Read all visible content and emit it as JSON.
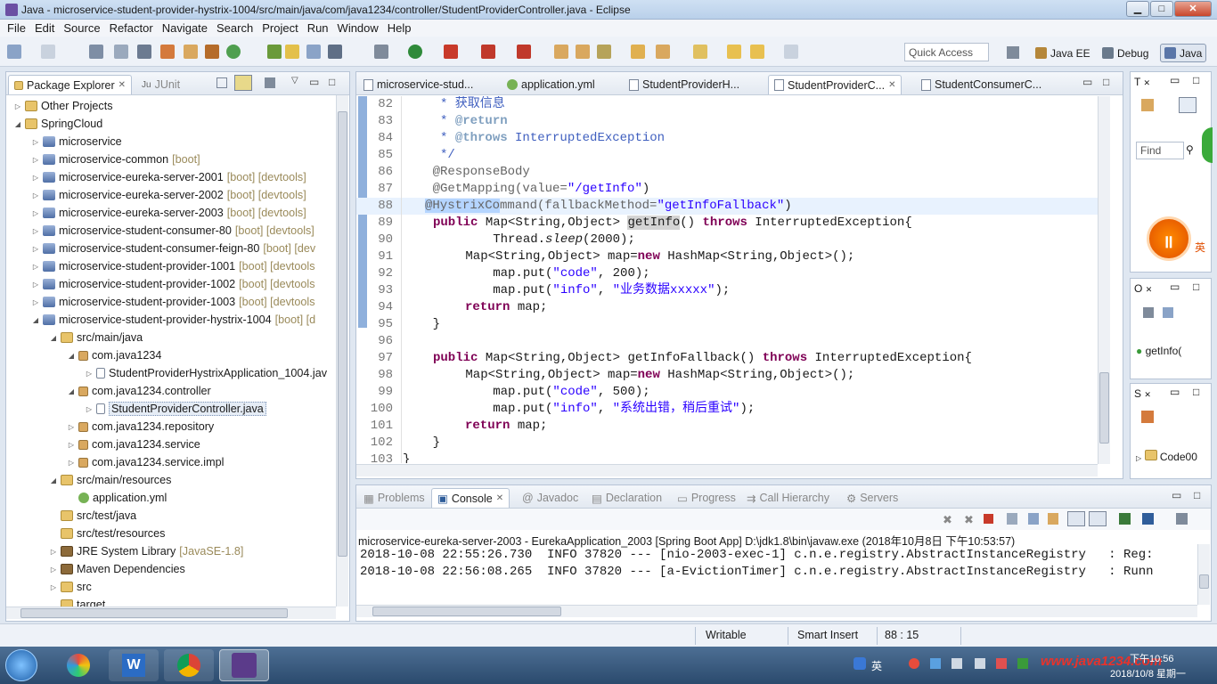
{
  "window": {
    "title": "Java - microservice-student-provider-hystrix-1004/src/main/java/com/java1234/controller/StudentProviderController.java - Eclipse",
    "minimize": "▁",
    "maximize": "□",
    "close": "✕"
  },
  "menu": [
    "File",
    "Edit",
    "Source",
    "Refactor",
    "Navigate",
    "Search",
    "Project",
    "Run",
    "Window",
    "Help"
  ],
  "toolbar": {
    "quick_access_placeholder": "Quick Access",
    "perspectives": [
      "Java EE",
      "Debug",
      "Java"
    ]
  },
  "package_explorer": {
    "tabs": [
      "Package Explorer",
      "JUnit"
    ],
    "items": [
      {
        "label": "Other Projects",
        "deco": ""
      },
      {
        "label": "SpringCloud",
        "deco": ""
      },
      {
        "label": "microservice",
        "deco": ""
      },
      {
        "label": "microservice-common",
        "deco": "[boot]"
      },
      {
        "label": "microservice-eureka-server-2001",
        "deco": "[boot] [devtools]"
      },
      {
        "label": "microservice-eureka-server-2002",
        "deco": "[boot] [devtools]"
      },
      {
        "label": "microservice-eureka-server-2003",
        "deco": "[boot] [devtools]"
      },
      {
        "label": "microservice-student-consumer-80",
        "deco": "[boot] [devtools]"
      },
      {
        "label": "microservice-student-consumer-feign-80",
        "deco": "[boot] [dev"
      },
      {
        "label": "microservice-student-provider-1001",
        "deco": "[boot] [devtools"
      },
      {
        "label": "microservice-student-provider-1002",
        "deco": "[boot] [devtools"
      },
      {
        "label": "microservice-student-provider-1003",
        "deco": "[boot] [devtools"
      },
      {
        "label": "microservice-student-provider-hystrix-1004",
        "deco": "[boot] [d"
      },
      {
        "label": "src/main/java",
        "deco": ""
      },
      {
        "label": "com.java1234",
        "deco": ""
      },
      {
        "label": "StudentProviderHystrixApplication_1004.jav",
        "deco": ""
      },
      {
        "label": "com.java1234.controller",
        "deco": ""
      },
      {
        "label": "StudentProviderController.java",
        "deco": ""
      },
      {
        "label": "com.java1234.repository",
        "deco": ""
      },
      {
        "label": "com.java1234.service",
        "deco": ""
      },
      {
        "label": "com.java1234.service.impl",
        "deco": ""
      },
      {
        "label": "src/main/resources",
        "deco": ""
      },
      {
        "label": "application.yml",
        "deco": ""
      },
      {
        "label": "src/test/java",
        "deco": ""
      },
      {
        "label": "src/test/resources",
        "deco": ""
      },
      {
        "label": "JRE System Library",
        "deco": "[JavaSE-1.8]"
      },
      {
        "label": "Maven Dependencies",
        "deco": ""
      },
      {
        "label": "src",
        "deco": ""
      },
      {
        "label": "target",
        "deco": ""
      }
    ]
  },
  "editor": {
    "tabs": [
      "microservice-stud...",
      "application.yml",
      "StudentProviderH...",
      "StudentProviderC...",
      "StudentConsumerC..."
    ],
    "line_numbers": [
      "82",
      "83",
      "84",
      "85",
      "86",
      "87",
      "88",
      "89",
      "90",
      "91",
      "92",
      "93",
      "94",
      "95",
      "96",
      "97",
      "98",
      "99",
      "100",
      "101",
      "102",
      "103"
    ],
    "snippets": {
      "l82": "     * 获取信息",
      "l83a": "     * ",
      "l83b": "@return",
      "l84a": "     * ",
      "l84b": "@throws",
      "l84c": " InterruptedException",
      "l85": "     */",
      "l86": "    @ResponseBody",
      "l87a": "    @GetMapping(value=",
      "l87b": "\"/getInfo\"",
      "l87c": ")",
      "l88a": "@HystrixCo",
      "l88b": "mmand(fallbackMethod=",
      "l88c": "\"getInfoFallback\"",
      "l88d": ")",
      "public": "public",
      "throws": "throws",
      "new": "new",
      "return": "return",
      "l89a": " Map<String,Object> ",
      "l89b": "getInfo",
      "l89c": "() ",
      "l89d": " InterruptedException{",
      "l90a": "        Thread.",
      "l90b": "sleep",
      "l90c": "(2000);",
      "map_decl": " Map<String,Object> map=",
      "hashmap": " HashMap<String,Object>();",
      "put_a": "        map.put(",
      "code_key": "\"code\"",
      "info_key": "\"info\"",
      "l92c": ", 200);",
      "l93c": ", ",
      "l93d": "\"业务数据xxxxx\"",
      "l93e": ");",
      "map_end": " map;",
      "close_inner": "    }",
      "l97a": " Map<String,Object> getInfoFallback() ",
      "l97b": " InterruptedException{",
      "l99c": ", 500);",
      "l100d": "\"系统出错，稍后重试\"",
      "close_class": "}"
    }
  },
  "right_views": {
    "t_tab": "T",
    "find_placeholder": "Find",
    "outline_tab": "O",
    "outline_item": "getInfo(",
    "s_tab": "S",
    "s_item": "Code00",
    "badge": "英"
  },
  "console": {
    "tabs": [
      "Problems",
      "Console",
      "Javadoc",
      "Declaration",
      "Progress",
      "Call Hierarchy",
      "Servers"
    ],
    "header": "microservice-eureka-server-2003 - EurekaApplication_2003 [Spring Boot App] D:\\jdk1.8\\bin\\javaw.exe (2018年10月8日 下午10:53:57)",
    "lines": [
      "2018-10-08 22:55:26.730  INFO 37820 --- [nio-2003-exec-1] c.n.e.registry.AbstractInstanceRegistry   : Reg:",
      "2018-10-08 22:56:08.265  INFO 37820 --- [a-EvictionTimer] c.n.e.registry.AbstractInstanceRegistry   : Runn"
    ]
  },
  "status": {
    "writable": "Writable",
    "insert_mode": "Smart Insert",
    "position": "88 : 15"
  },
  "taskbar": {
    "ime": "英",
    "watermark": "www.java1234.com",
    "time": "下午10:56",
    "date": "2018/10/8 星期一"
  },
  "colors": {
    "keyword": "#7f0055",
    "comment": "#3f5fbf",
    "string": "#2a00ff",
    "annotation": "#646464"
  }
}
